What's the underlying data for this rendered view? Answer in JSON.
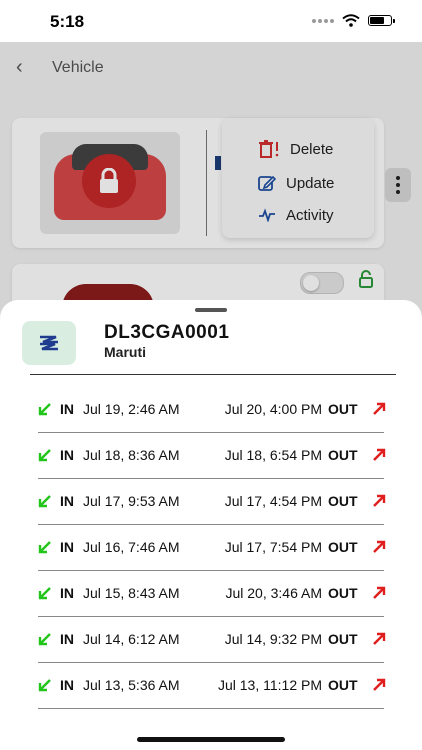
{
  "status_bar": {
    "time": "5:18"
  },
  "nav": {
    "title": "Vehicle"
  },
  "menu": {
    "delete": "Delete",
    "update": "Update",
    "activity": "Activity"
  },
  "sheet": {
    "plate": "DL3CGA0001",
    "brand": "Maruti",
    "in_label": "IN",
    "out_label": "OUT",
    "records": [
      {
        "in": "Jul 19, 2:46 AM",
        "out": "Jul 20, 4:00 PM"
      },
      {
        "in": "Jul 18, 8:36 AM",
        "out": "Jul 18, 6:54 PM"
      },
      {
        "in": "Jul 17, 9:53 AM",
        "out": "Jul 17, 4:54 PM"
      },
      {
        "in": "Jul 16, 7:46 AM",
        "out": "Jul 17, 7:54 PM"
      },
      {
        "in": "Jul 15, 8:43 AM",
        "out": "Jul 20, 3:46 AM"
      },
      {
        "in": "Jul 14, 6:12 AM",
        "out": "Jul 14, 9:32 PM"
      },
      {
        "in": "Jul 13, 5:36 AM",
        "out": "Jul 13, 11:12 PM"
      }
    ]
  },
  "colors": {
    "in_arrow": "#22c51a",
    "out_arrow": "#e01e1e",
    "lock_red": "#c62828"
  }
}
